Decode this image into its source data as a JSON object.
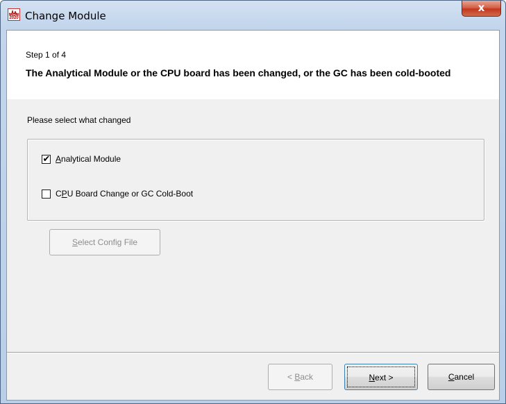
{
  "window": {
    "title": "Change Module",
    "icon_text": "MON 2020",
    "close_symbol": "x"
  },
  "header": {
    "step": "Step 1 of 4",
    "heading": "The Analytical Module or the CPU board has been changed, or the GC has been cold-booted"
  },
  "body": {
    "prompt": "Please select what changed",
    "options": [
      {
        "mnemonic": "A",
        "rest": "nalytical Module",
        "checked": true
      },
      {
        "prefix": "C",
        "mnemonic": "P",
        "rest": "U Board Change or GC Cold-Boot",
        "checked": false
      }
    ],
    "select_config": {
      "mnemonic": "S",
      "rest": "elect Config File",
      "enabled": false
    }
  },
  "footer": {
    "back": {
      "prefix": "< ",
      "mnemonic": "B",
      "rest": "ack",
      "enabled": false
    },
    "next": {
      "mnemonic": "N",
      "rest": "ext >"
    },
    "cancel": {
      "mnemonic": "C",
      "rest": "ancel"
    }
  },
  "colors": {
    "title_gradient_top": "#d3e1f1",
    "close_button": "#c0391e",
    "dialog_bg": "#f0f0f0",
    "header_bg": "#ffffff"
  }
}
